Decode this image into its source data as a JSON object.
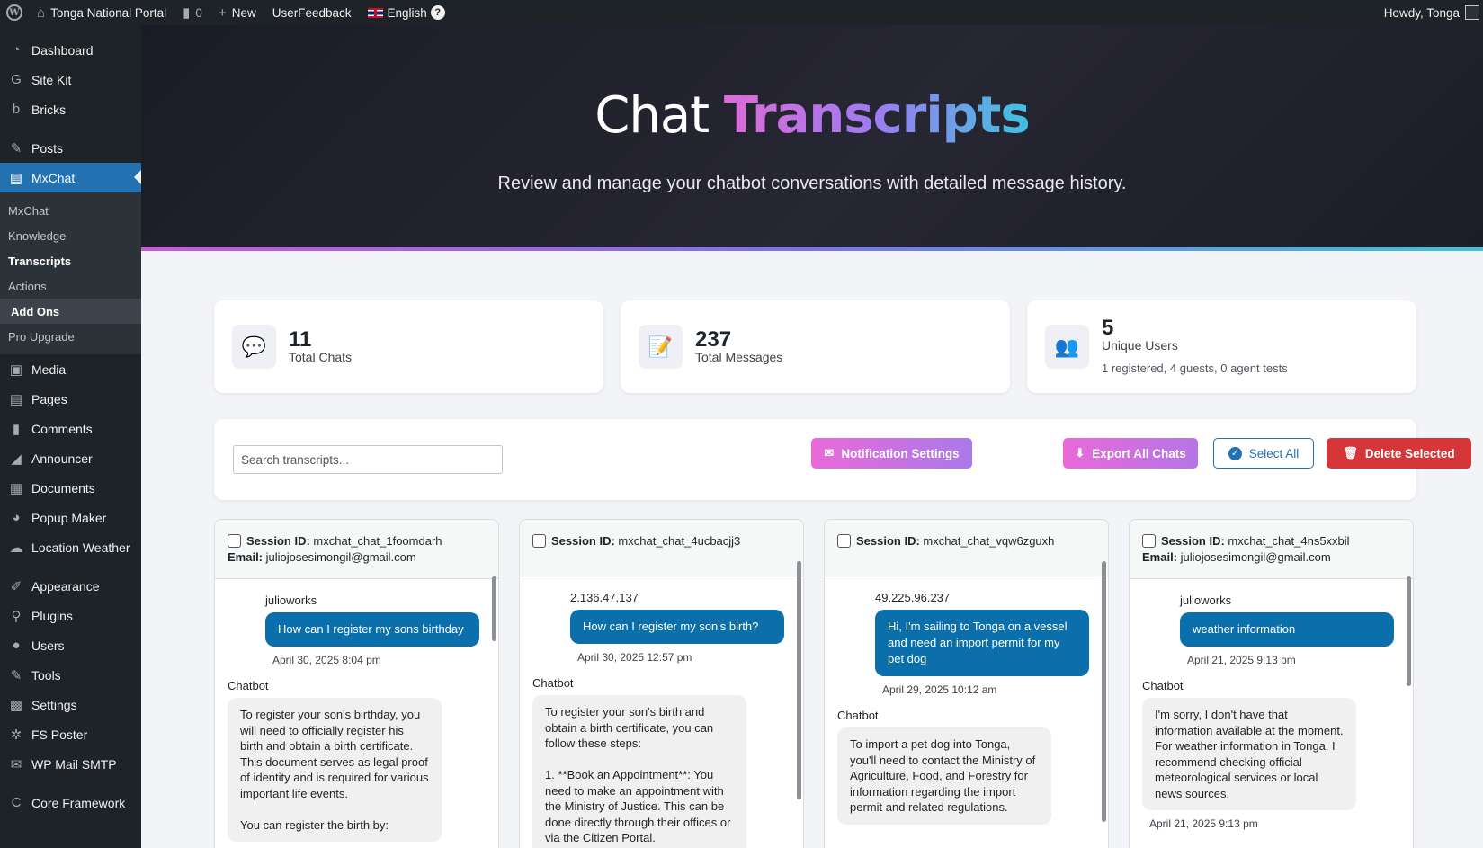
{
  "adminbar": {
    "site_name": "Tonga National Portal",
    "comments_count": "0",
    "new_label": "New",
    "feedback_label": "UserFeedback",
    "language_label": "English",
    "howdy": "Howdy, Tonga"
  },
  "sidebar": {
    "items_top": [
      {
        "label": "Dashboard",
        "icon": "dashboard-icon",
        "glyph": "◔"
      },
      {
        "label": "Site Kit",
        "icon": "sitekit-icon",
        "glyph": "G"
      },
      {
        "label": "Bricks",
        "icon": "bricks-icon",
        "glyph": "b"
      }
    ],
    "items_mid": [
      {
        "label": "Posts",
        "icon": "pin-icon",
        "glyph": "✎"
      },
      {
        "label": "MxChat",
        "icon": "chat-icon",
        "glyph": "▤"
      }
    ],
    "submenu": [
      {
        "label": "MxChat"
      },
      {
        "label": "Knowledge"
      },
      {
        "label": "Transcripts"
      },
      {
        "label": "Actions"
      },
      {
        "label": "Add Ons"
      },
      {
        "label": "Pro Upgrade"
      }
    ],
    "items_bottom": [
      {
        "label": "Media",
        "icon": "media-icon",
        "glyph": "▣"
      },
      {
        "label": "Pages",
        "icon": "pages-icon",
        "glyph": "▤"
      },
      {
        "label": "Comments",
        "icon": "comments-icon",
        "glyph": "▮"
      },
      {
        "label": "Announcer",
        "icon": "announcer-icon",
        "glyph": "◢"
      },
      {
        "label": "Documents",
        "icon": "documents-icon",
        "glyph": "▦"
      },
      {
        "label": "Popup Maker",
        "icon": "popup-icon",
        "glyph": "◕"
      },
      {
        "label": "Location Weather",
        "icon": "weather-icon",
        "glyph": "☁"
      }
    ],
    "items_tools": [
      {
        "label": "Appearance",
        "icon": "appearance-icon",
        "glyph": "✐"
      },
      {
        "label": "Plugins",
        "icon": "plugins-icon",
        "glyph": "⚲"
      },
      {
        "label": "Users",
        "icon": "users-icon",
        "glyph": "●"
      },
      {
        "label": "Tools",
        "icon": "tools-icon",
        "glyph": "✎"
      },
      {
        "label": "Settings",
        "icon": "settings-icon",
        "glyph": "▩"
      },
      {
        "label": "FS Poster",
        "icon": "fsposter-icon",
        "glyph": "✲"
      },
      {
        "label": "WP Mail SMTP",
        "icon": "mail-icon",
        "glyph": "✉"
      }
    ],
    "items_last": [
      {
        "label": "Core Framework",
        "icon": "core-icon",
        "glyph": "C"
      }
    ]
  },
  "hero": {
    "title_plain": "Chat ",
    "title_accent": "Transcripts",
    "subtitle": "Review and manage your chatbot conversations with detailed message history."
  },
  "stats": {
    "chats": {
      "number": "11",
      "label": "Total Chats"
    },
    "messages": {
      "number": "237",
      "label": "Total Messages"
    },
    "users": {
      "number": "5",
      "label": "Unique Users",
      "extra": "1 registered, 4 guests, 0 agent tests"
    }
  },
  "toolbar": {
    "search_placeholder": "Search transcripts...",
    "notif_label": "Notification Settings",
    "export_label": "Export All Chats",
    "select_label": "Select All",
    "delete_label": "Delete Selected"
  },
  "transcripts": [
    {
      "session_label": "Session ID:",
      "session_id": "mxchat_chat_1foomdarh",
      "email_label": "Email:",
      "email": "juliojosesimongil@gmail.com",
      "user": "julioworks",
      "user_message": "How can I register my sons birthday",
      "user_time": "April 30, 2025 8:04 pm",
      "bot_label": "Chatbot",
      "bot_message": "To register your son's birthday, you will need to officially register his birth and obtain a birth certificate. This document serves as legal proof of identity and is required for various important life events.\n\nYou can register the birth by:",
      "bot_time": ""
    },
    {
      "session_label": "Session ID:",
      "session_id": "mxchat_chat_4ucbacjj3",
      "email_label": "",
      "email": "",
      "user": "2.136.47.137",
      "user_message": "How can I register my son's birth?",
      "user_time": "April 30, 2025 12:57 pm",
      "bot_label": "Chatbot",
      "bot_message": "To register your son's birth and obtain a birth certificate, you can follow these steps:\n\n1. **Book an Appointment**: You need to make an appointment with the Ministry of Justice. This can be done directly through their offices or via the Citizen Portal.",
      "bot_time": ""
    },
    {
      "session_label": "Session ID:",
      "session_id": "mxchat_chat_vqw6zguxh",
      "email_label": "",
      "email": "",
      "user": "49.225.96.237",
      "user_message": "Hi, I'm sailing to Tonga on a vessel and need an import permit for my pet dog",
      "user_time": "April 29, 2025 10:12 am",
      "bot_label": "Chatbot",
      "bot_message": "To import a pet dog into Tonga, you'll need to contact the Ministry of Agriculture, Food, and Forestry for information regarding the import permit and related regulations.",
      "bot_time": ""
    },
    {
      "session_label": "Session ID:",
      "session_id": "mxchat_chat_4ns5xxbil",
      "email_label": "Email:",
      "email": "juliojosesimongil@gmail.com",
      "user": "julioworks",
      "user_message": "weather information",
      "user_time": "April 21, 2025 9:13 pm",
      "bot_label": "Chatbot",
      "bot_message": "I'm sorry, I don't have that information available at the moment. For weather information in Tonga, I recommend checking official meteorological services or local news sources.",
      "bot_time": "April 21, 2025 9:13 pm"
    }
  ]
}
